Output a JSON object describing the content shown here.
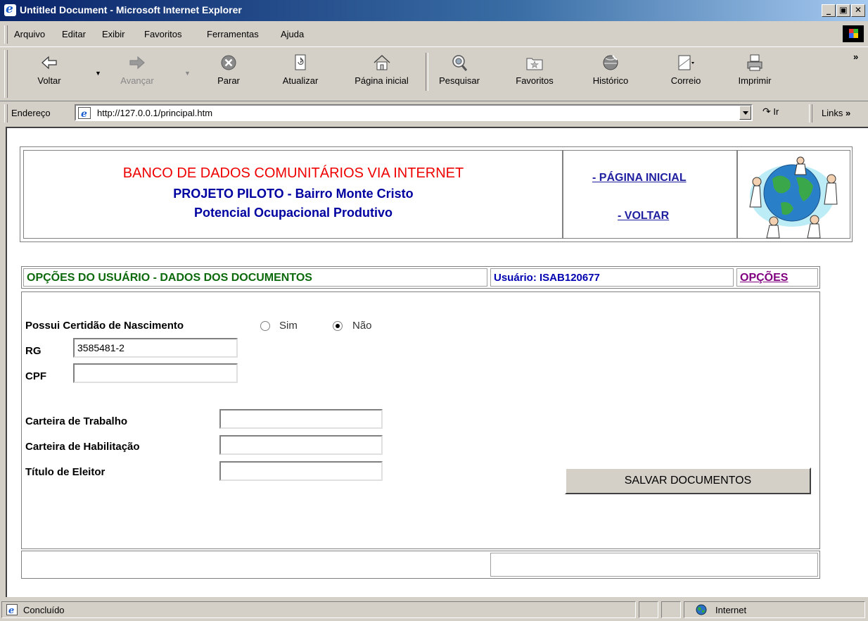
{
  "window": {
    "title": "Untitled Document - Microsoft Internet Explorer"
  },
  "menu": [
    "Arquivo",
    "Editar",
    "Exibir",
    "Favoritos",
    "Ferramentas",
    "Ajuda"
  ],
  "toolbar": {
    "back": "Voltar",
    "forward": "Avançar",
    "stop": "Parar",
    "refresh": "Atualizar",
    "home": "Página inicial",
    "search": "Pesquisar",
    "favorites": "Favoritos",
    "history": "Histórico",
    "mail": "Correio",
    "print": "Imprimir",
    "more": "»"
  },
  "address": {
    "label": "Endereço",
    "url": "http://127.0.0.1/principal.htm",
    "go": "Ir",
    "links": "Links"
  },
  "header": {
    "title_red": "BANCO DE DADOS COMUNITÁRIOS VIA INTERNET",
    "line2": "PROJETO PILOTO - Bairro Monte Cristo",
    "line3": "Potencial Ocupacional Produtivo",
    "link_home": "- PÁGINA INICIAL",
    "link_back": "- VOLTAR"
  },
  "section": {
    "title": "OPÇÕES DO USUÁRIO - DADOS DOS DOCUMENTOS",
    "user": "Usuário: ISAB120677",
    "options": "OPÇÕES"
  },
  "form": {
    "birth_cert_label": "Possui Certidão de Nascimento",
    "opt_yes": "Sim",
    "opt_no": "Não",
    "birth_cert_value": "Não",
    "rg_label": "RG",
    "rg_value": "3585481-2",
    "cpf_label": "CPF",
    "cpf_value": "",
    "work_label": "Carteira de Trabalho",
    "work_value": "",
    "license_label": "Carteira de Habilitação",
    "license_value": "",
    "voter_label": "Título de Eleitor",
    "voter_value": "",
    "save": "SALVAR DOCUMENTOS"
  },
  "status": {
    "text": "Concluído",
    "zone": "Internet"
  }
}
